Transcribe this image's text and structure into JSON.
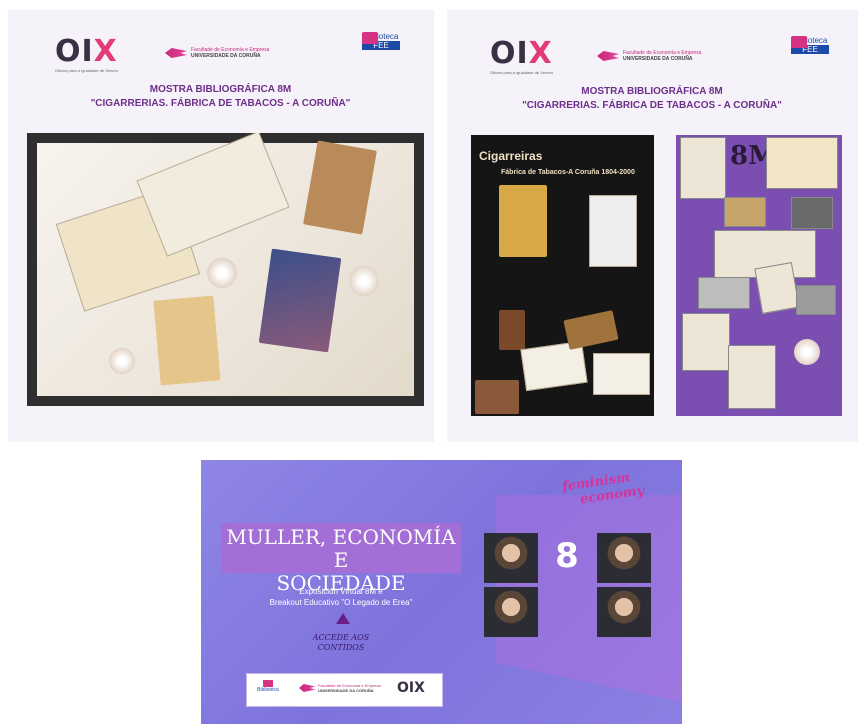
{
  "left_panel": {
    "oix_logo": {
      "o": "OI",
      "x": "X",
      "subtitle": "Oficina para a Igualdade de Xénero"
    },
    "fee_logo": {
      "line1": "Facultade de Economía e Empresa",
      "line2": "UNIVERSIDADE DA CORUÑA"
    },
    "biblioteca_logo": {
      "line1": "Biblioteca",
      "line2": "FEE"
    },
    "title_line1": "MOSTRA BIBLIOGRÁFICA 8M",
    "title_line2": "\"CIGARRERIAS. FÁBRICA DE TABACOS - A CORUÑA\""
  },
  "right_panel": {
    "oix_logo": {
      "o": "OI",
      "x": "X",
      "subtitle": "Oficina para a Igualdade de Xénero"
    },
    "fee_logo": {
      "line1": "Facultade de Economía e Empresa",
      "line2": "UNIVERSIDADE DA CORUÑA"
    },
    "biblioteca_logo": {
      "line1": "Biblioteca",
      "line2": "FEE"
    },
    "title_line1": "MOSTRA BIBLIOGRÁFICA 8M",
    "title_line2": "\"CIGARRERIAS. FÁBRICA DE TABACOS - A CORUÑA\"",
    "photo_title_line1": "Cigarreiras",
    "photo_title_line2": "Fábrica de Tabacos-A Coruña 1804-2000",
    "photo_purple_label": "8M"
  },
  "banner": {
    "title_line1": "MULLER, ECONOMÍA E",
    "title_line2": "SOCIEDADE",
    "subtitle_line1": "Exposición Virtual 8M e",
    "subtitle_line2": "Breakout Educativo \"O Legado de Erea\"",
    "access_line1": "ACCEDE AOS",
    "access_line2": "CONTIDOS",
    "feminism_line1": "feminism",
    "feminism_line2": "economy",
    "center_label": "8",
    "footer": {
      "biblioteca": "Biblioteca",
      "fee_line1": "Facultade de Economía e Empresa",
      "fee_line2": "UNIVERSIDADE DA CORUÑA",
      "oix": "OIX"
    }
  },
  "colors": {
    "title_purple": "#6d2f8a",
    "oix_pink": "#e23b7a",
    "banner_violet": "#8f86e6",
    "biblioteca_blue": "#1d4aa6"
  }
}
